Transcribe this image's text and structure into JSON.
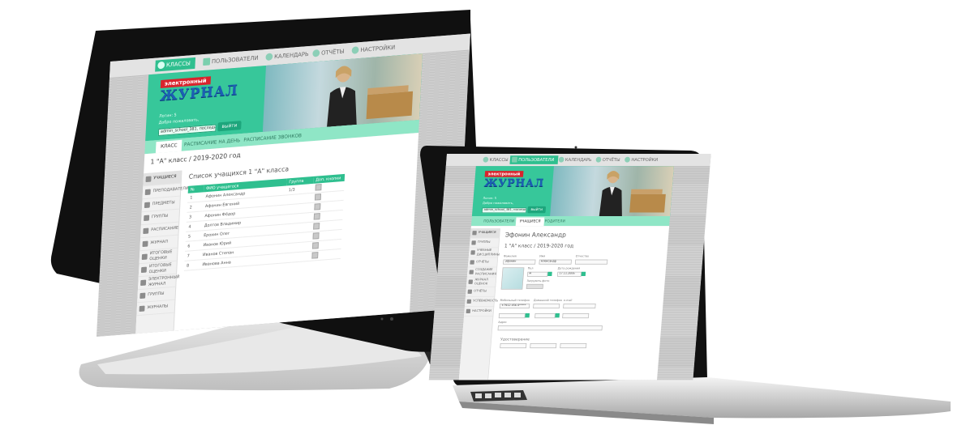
{
  "nav": {
    "items": [
      "КЛАССЫ",
      "ПОЛЬЗОВАТЕЛИ",
      "КАЛЕНДАРЬ",
      "ОТЧЁТЫ",
      "НАСТРОЙКИ"
    ],
    "active": "КЛАССЫ"
  },
  "banner": {
    "logo_top": "электронный",
    "logo_main": "ЖУРНАЛ",
    "user_line1": "Логин: 5",
    "user_line2": "Добро пожаловать,",
    "login_value": "admin_school_381, последний вход 15:20",
    "exit_label": "выйти"
  },
  "monitor": {
    "subtabs": [
      "КЛАСС",
      "РАСПИСАНИЕ НА ДЕНЬ",
      "РАСПИСАНИЕ ЗВОНКОВ"
    ],
    "crumb": "1 \"А\" класс / 2019-2020 год",
    "sidebar": [
      "УЧАЩИЕСЯ",
      "ПРЕПОДАВАТЕЛИ",
      "ПРЕДМЕТЫ",
      "ГРУППЫ",
      "РАСПИСАНИЕ",
      "ЖУРНАЛ",
      "ИТОГОВЫЕ ОЦЕНКИ",
      "ИТОГОВЫЕ ОЦЕНКИ",
      "ЭЛЕКТРОННЫЙ ЖУРНАЛ",
      "ГРУППЫ",
      "ЖУРНАЛЫ"
    ],
    "list_title": "Список учащихся 1 \"А\" класса",
    "columns": [
      "№",
      "ФИО учащегося",
      "Группа",
      "Доп. кнопки"
    ],
    "rows": [
      {
        "n": "1",
        "name": "Афонин Александр",
        "group": "1/3"
      },
      {
        "n": "2",
        "name": "Афонин Евгений",
        "group": ""
      },
      {
        "n": "3",
        "name": "Афонин Фёдор",
        "group": ""
      },
      {
        "n": "4",
        "name": "Долгов Владимир",
        "group": ""
      },
      {
        "n": "5",
        "name": "Ерохин Олег",
        "group": ""
      },
      {
        "n": "6",
        "name": "Иванов Юрий",
        "group": ""
      },
      {
        "n": "7",
        "name": "Иванов Степан",
        "group": ""
      },
      {
        "n": "8",
        "name": "Иванова Анна",
        "group": ""
      }
    ]
  },
  "laptop": {
    "subtabs": [
      "ПОЛЬЗОВАТЕЛИ",
      "УЧАЩИЕСЯ",
      "РОДИТЕЛИ"
    ],
    "sidebar": [
      "УЧАЩИЕСЯ",
      "ГРУППЫ",
      "УЧЕБНЫЕ ДИСЦИПЛИНЫ",
      "ОТЧЁТЫ",
      "СОЗДАНИЕ РАСПИСАНИЯ",
      "ЖУРНАЛ ОЦЕНОК",
      "ОТЧЁТЫ",
      "УСПЕВАЕМОСТЬ",
      "НАСТРОЙКИ"
    ],
    "student_name": "Эфонин Александр",
    "student_class": "1 \"А\" класс / 2019-2020 год",
    "fields": {
      "surname_label": "Фамилия",
      "surname_value": "Эфонин",
      "name_label": "Имя",
      "name_value": "Александр",
      "patronymic_label": "Отчество",
      "gender_label": "Пол",
      "gender_value": "м",
      "birthdate_label": "Дата рождения",
      "birthdate_value": "17.11.2006",
      "photo_label": "Загрузить фото",
      "phone_label": "Мобильный телефон",
      "phone_value": "+7912 456 0*****",
      "home_phone_label": "Домашний телефон",
      "email_label": "e-mail",
      "address_label": "Адрес",
      "docs_label": "Удостоверение"
    }
  }
}
